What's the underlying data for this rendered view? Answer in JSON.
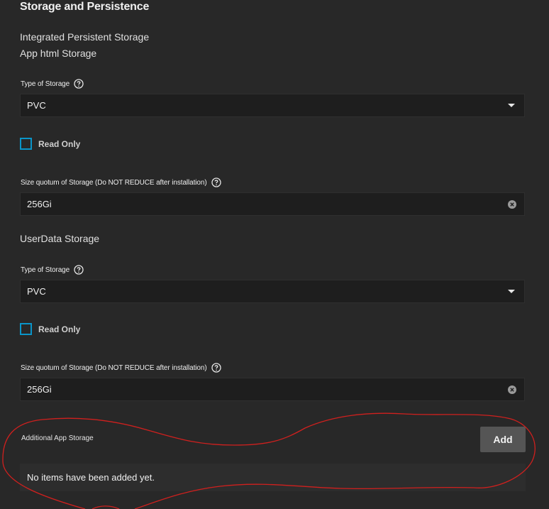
{
  "section": {
    "title": "Storage and Persistence"
  },
  "integrated": {
    "title": "Integrated Persistent Storage",
    "app_storage": {
      "title": "App html Storage",
      "type_label": "Type of Storage",
      "type_value": "PVC",
      "read_only_label": "Read Only",
      "read_only_checked": false,
      "size_label": "Size quotum of Storage (Do NOT REDUCE after installation)",
      "size_value": "256Gi"
    },
    "userdata_storage": {
      "title": "UserData Storage",
      "type_label": "Type of Storage",
      "type_value": "PVC",
      "read_only_label": "Read Only",
      "read_only_checked": false,
      "size_label": "Size quotum of Storage (Do NOT REDUCE after installation)",
      "size_value": "256Gi"
    }
  },
  "additional": {
    "label": "Additional App Storage",
    "add_button_label": "Add",
    "empty_text": "No items have been added yet."
  },
  "colors": {
    "background": "#282828",
    "input_background": "#1e1e1e",
    "checkbox_border": "#0a95c9",
    "button_background": "#555555",
    "annotation_stroke": "#d0201e"
  }
}
